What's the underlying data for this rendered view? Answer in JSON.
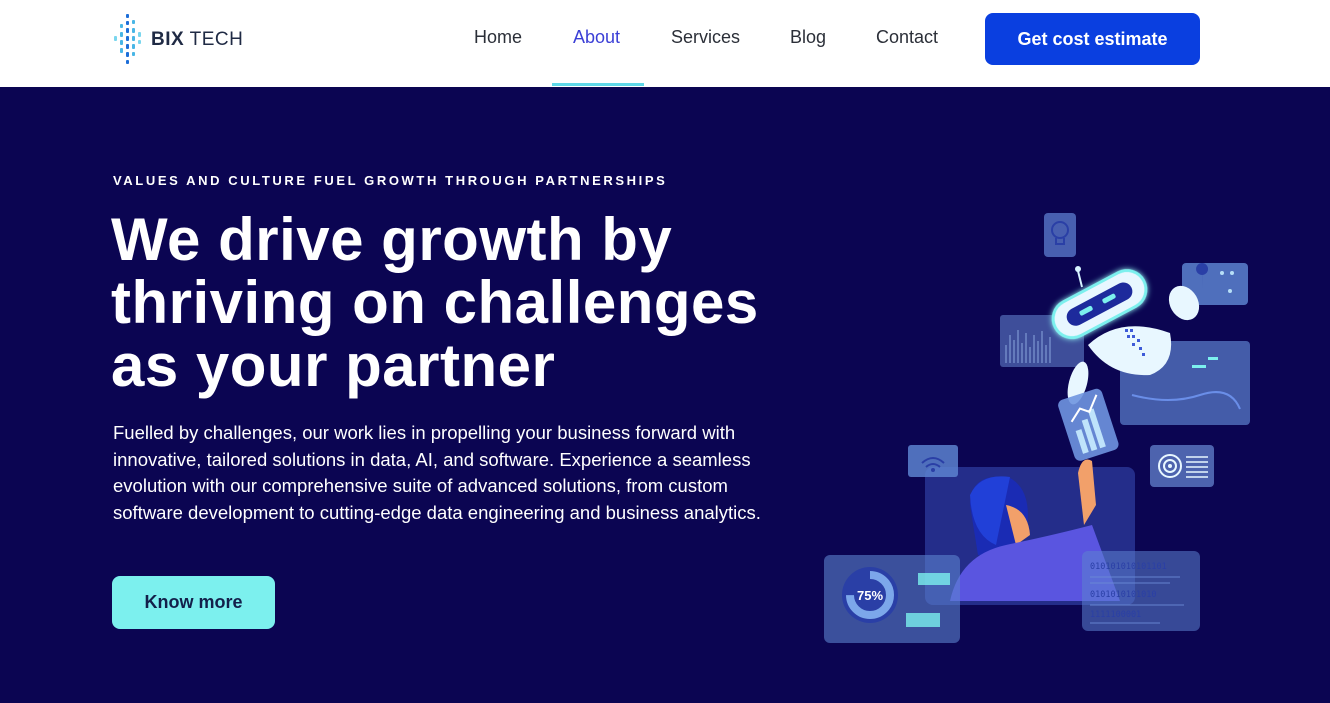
{
  "brand": {
    "bold": "BIX",
    "light": " TECH"
  },
  "nav": {
    "items": [
      {
        "label": "Home"
      },
      {
        "label": "About"
      },
      {
        "label": "Services"
      },
      {
        "label": "Blog"
      },
      {
        "label": "Contact"
      }
    ],
    "cta_label": "Get cost estimate"
  },
  "hero": {
    "eyebrow": "VALUES AND CULTURE FUEL GROWTH THROUGH PARTNERSHIPS",
    "headline_lines": [
      "We drive growth by",
      "thriving on challenges",
      "as your partner"
    ],
    "description": "Fuelled by challenges, our work lies in propelling your business forward with innovative, tailored solutions in data, AI, and software. Experience a seamless evolution with our comprehensive suite of advanced solutions, from custom software development to cutting-edge data engineering and business analytics.",
    "button_label": "Know more"
  },
  "illustration": {
    "gauge_label": "75%",
    "binary_lines": [
      "010101010101101",
      "0101010101010",
      "1111100001"
    ]
  },
  "colors": {
    "hero_bg": "#0b0552",
    "cta_bg": "#0a3fe0",
    "accent_cyan": "#7cf0ee",
    "active_link": "#3b3fd6"
  }
}
